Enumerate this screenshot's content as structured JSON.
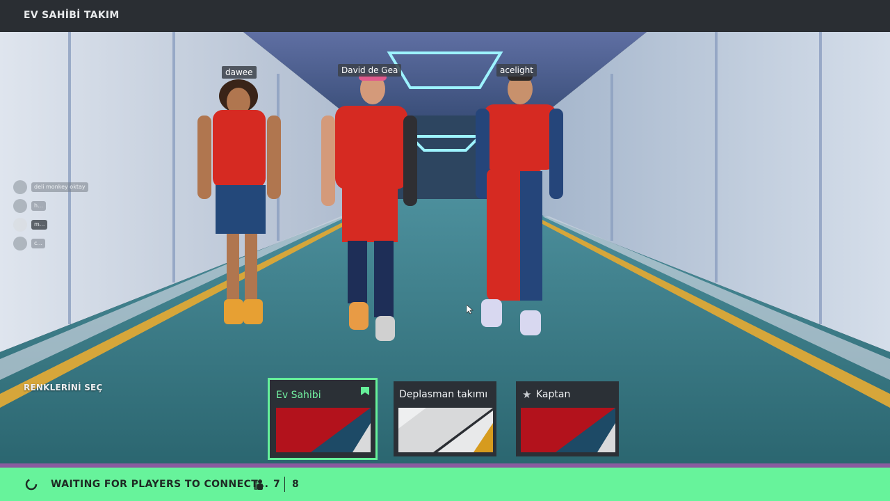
{
  "header": {
    "title": "EV SAHİBİ TAKIM"
  },
  "players": [
    {
      "name": "dawee"
    },
    {
      "name": "David de Gea"
    },
    {
      "name": "acelight"
    }
  ],
  "social": [
    {
      "label": "deli monkey oktay"
    },
    {
      "label": "h..."
    },
    {
      "label": "m..."
    },
    {
      "label": "c..."
    }
  ],
  "kits": {
    "section_label": "RENKLERİNİ SEÇ",
    "options": [
      {
        "label": "Ev Sahibi",
        "selected": true,
        "colors": [
          "#b3121c",
          "#1d4a66",
          "#d9dadb"
        ]
      },
      {
        "label": "Deplasman takımı",
        "selected": false,
        "colors": [
          "#d8d9da",
          "#e8e9ea",
          "#d69b1e"
        ]
      },
      {
        "label": "Kaptan",
        "selected": false,
        "colors": [
          "#b3121c",
          "#1d4a66",
          "#d9dadb"
        ]
      }
    ]
  },
  "status": {
    "message": "WAITING FOR PLAYERS TO CONNECT...",
    "connected": "7",
    "total": "8"
  },
  "colors": {
    "accent": "#67f39b",
    "topbar": "#2a2e33",
    "kit_red": "#b3121c",
    "kit_navy": "#1d4a66"
  }
}
